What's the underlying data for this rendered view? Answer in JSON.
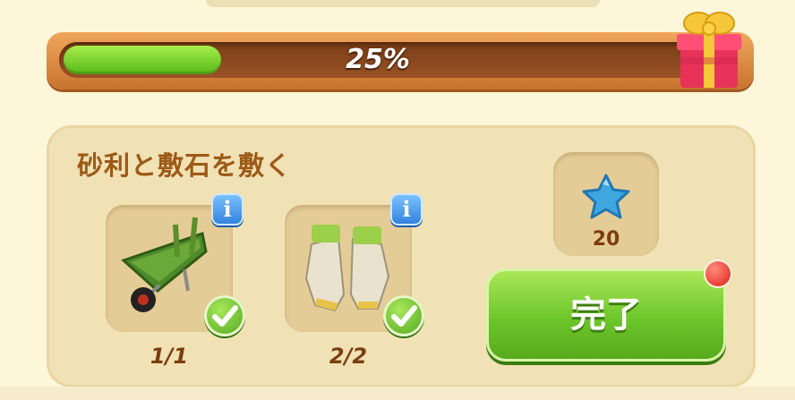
{
  "progress": {
    "percent_text": "25%",
    "percent": 25
  },
  "task": {
    "title": "砂利と敷石を敷く",
    "items": [
      {
        "icon": "wheelbarrow-icon",
        "count": "1/1",
        "info_label": "i",
        "done": true
      },
      {
        "icon": "gloves-icon",
        "count": "2/2",
        "info_label": "i",
        "done": true
      }
    ],
    "reward": {
      "icon": "blue-star-icon",
      "amount": "20"
    },
    "complete_button": "完了"
  },
  "colors": {
    "accent_green": "#6cc62a",
    "progress_brown": "#9a5326",
    "title_brown": "#9c5a16"
  }
}
